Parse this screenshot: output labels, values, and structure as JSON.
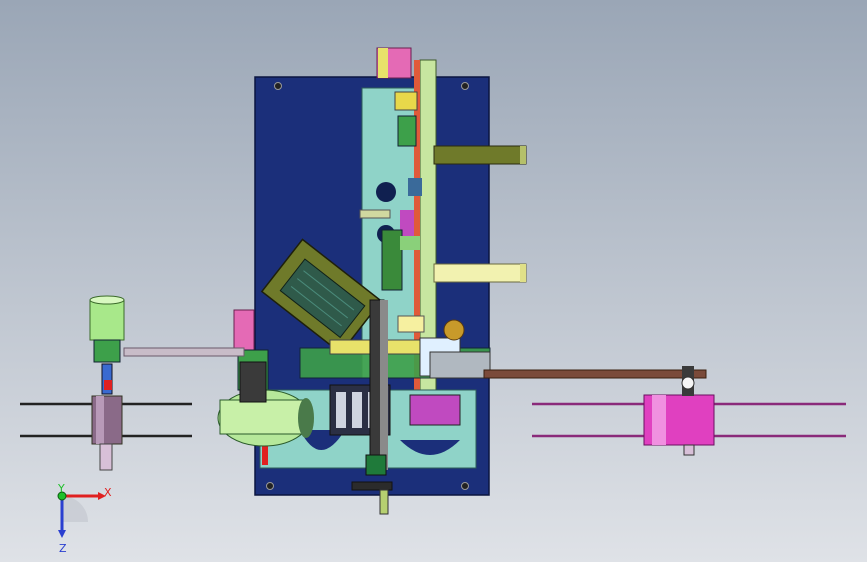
{
  "viewport": {
    "background_top": "#9aa6b6",
    "background_bottom": "#dfe2e7"
  },
  "triad": {
    "x_label": "X",
    "y_label": "Y",
    "z_label": "Z",
    "x_color": "#e02020",
    "y_color": "#1fbf2a",
    "z_color": "#2a3fd0"
  },
  "colors": {
    "base_plate": "#1b2f7a",
    "frame": "#8fd3c8",
    "motor_green": "#6f7a2a",
    "reel_magenta": "#e040c0",
    "spool_green": "#b6e89a",
    "accent_yellow": "#f2f2b0",
    "brown_belt": "#7a4a3a"
  }
}
